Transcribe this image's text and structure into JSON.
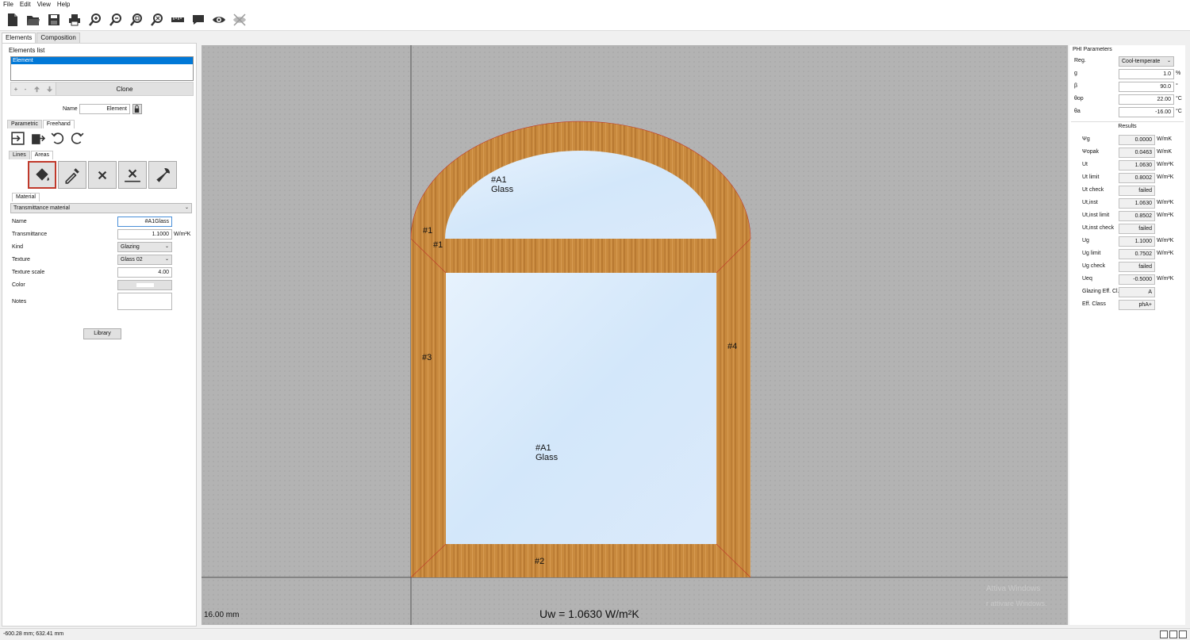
{
  "menu": [
    "File",
    "Edit",
    "View",
    "Help"
  ],
  "toolbar_icons": [
    "new-file-icon",
    "open-folder-icon",
    "save-icon",
    "print-icon",
    "zoom-in-icon",
    "zoom-out-icon",
    "zoom-fit-icon",
    "zoom-reset-icon",
    "ruler-icon",
    "comment-icon",
    "eye-icon",
    "hide-icon"
  ],
  "left": {
    "tabs": [
      "Elements",
      "Composition"
    ],
    "elements_list_title": "Elements list",
    "elements": [
      "Element"
    ],
    "list_buttons": [
      "+",
      "-"
    ],
    "clone_label": "Clone",
    "name_label": "Name",
    "name_value": "Element",
    "mode_tabs": [
      "Parametric",
      "Freehand"
    ],
    "draw_tabs": [
      "Lines",
      "Areas"
    ],
    "material_tab": "Material",
    "material_type": "Transmittance material",
    "props": {
      "name_label": "Name",
      "name_value": "#A1Glass",
      "transmittance_label": "Transmittance",
      "transmittance_value": "1.1000",
      "transmittance_unit": "W/m²K",
      "kind_label": "Kind",
      "kind_value": "Glazing",
      "texture_label": "Texture",
      "texture_value": "Glass 02",
      "texture_scale_label": "Texture scale",
      "texture_scale_value": "4.00",
      "color_label": "Color",
      "notes_label": "Notes"
    },
    "library_label": "Library"
  },
  "canvas": {
    "labels": {
      "top_glass_id": "#A1",
      "top_glass_name": "Glass",
      "main_glass_id": "#A1",
      "main_glass_name": "Glass",
      "frame1a": "#1",
      "frame1b": "#1",
      "frame2": "#2",
      "frame3": "#3",
      "frame4": "#4"
    },
    "scale": "16.00 mm",
    "uw": "Uw = 1.0630 W/m²K"
  },
  "phi": {
    "title": "PHI Parameters",
    "params": [
      {
        "label": "Reg.",
        "value": "Cool-temperate",
        "unit": "",
        "combo": true
      },
      {
        "label": "g",
        "value": "1.0",
        "unit": "%"
      },
      {
        "label": "β",
        "value": "90.0",
        "unit": "°"
      },
      {
        "label": "θop",
        "value": "22.00",
        "unit": "°C"
      },
      {
        "label": "θa",
        "value": "-16.00",
        "unit": "°C"
      }
    ],
    "results_title": "Results",
    "results": [
      {
        "label": "Ψg",
        "value": "0.0000",
        "unit": "W/mK"
      },
      {
        "label": "Ψopak",
        "value": "0.0463",
        "unit": "W/mK"
      },
      {
        "label": "Ut",
        "value": "1.0630",
        "unit": "W/m²K"
      },
      {
        "label": "Ut limit",
        "value": "0.8002",
        "unit": "W/m²K"
      },
      {
        "label": "Ut check",
        "value": "failed",
        "unit": ""
      },
      {
        "label": "Ut,inst",
        "value": "1.0630",
        "unit": "W/m²K"
      },
      {
        "label": "Ut,inst limit",
        "value": "0.8502",
        "unit": "W/m²K"
      },
      {
        "label": "Ut,inst check",
        "value": "failed",
        "unit": ""
      },
      {
        "label": "Ug",
        "value": "1.1000",
        "unit": "W/m²K"
      },
      {
        "label": "Ug limit",
        "value": "0.7502",
        "unit": "W/m²K"
      },
      {
        "label": "Ug check",
        "value": "failed",
        "unit": ""
      },
      {
        "label": "Ueq",
        "value": "-0.5000",
        "unit": "W/m²K"
      },
      {
        "label": "Glazing Eff. Cl.",
        "value": "A",
        "unit": ""
      },
      {
        "label": "Eff. Class",
        "value": "phA+",
        "unit": ""
      }
    ]
  },
  "watermark": {
    "line1": "Attiva Windows",
    "line2": "r attivare Windows."
  },
  "status": "-600.28 mm; 632.41 mm",
  "colors": {
    "wood": "#c98a3e",
    "glass": "#d6e9fb",
    "canvas": "#b3b3b3",
    "selection": "#0078d7"
  }
}
